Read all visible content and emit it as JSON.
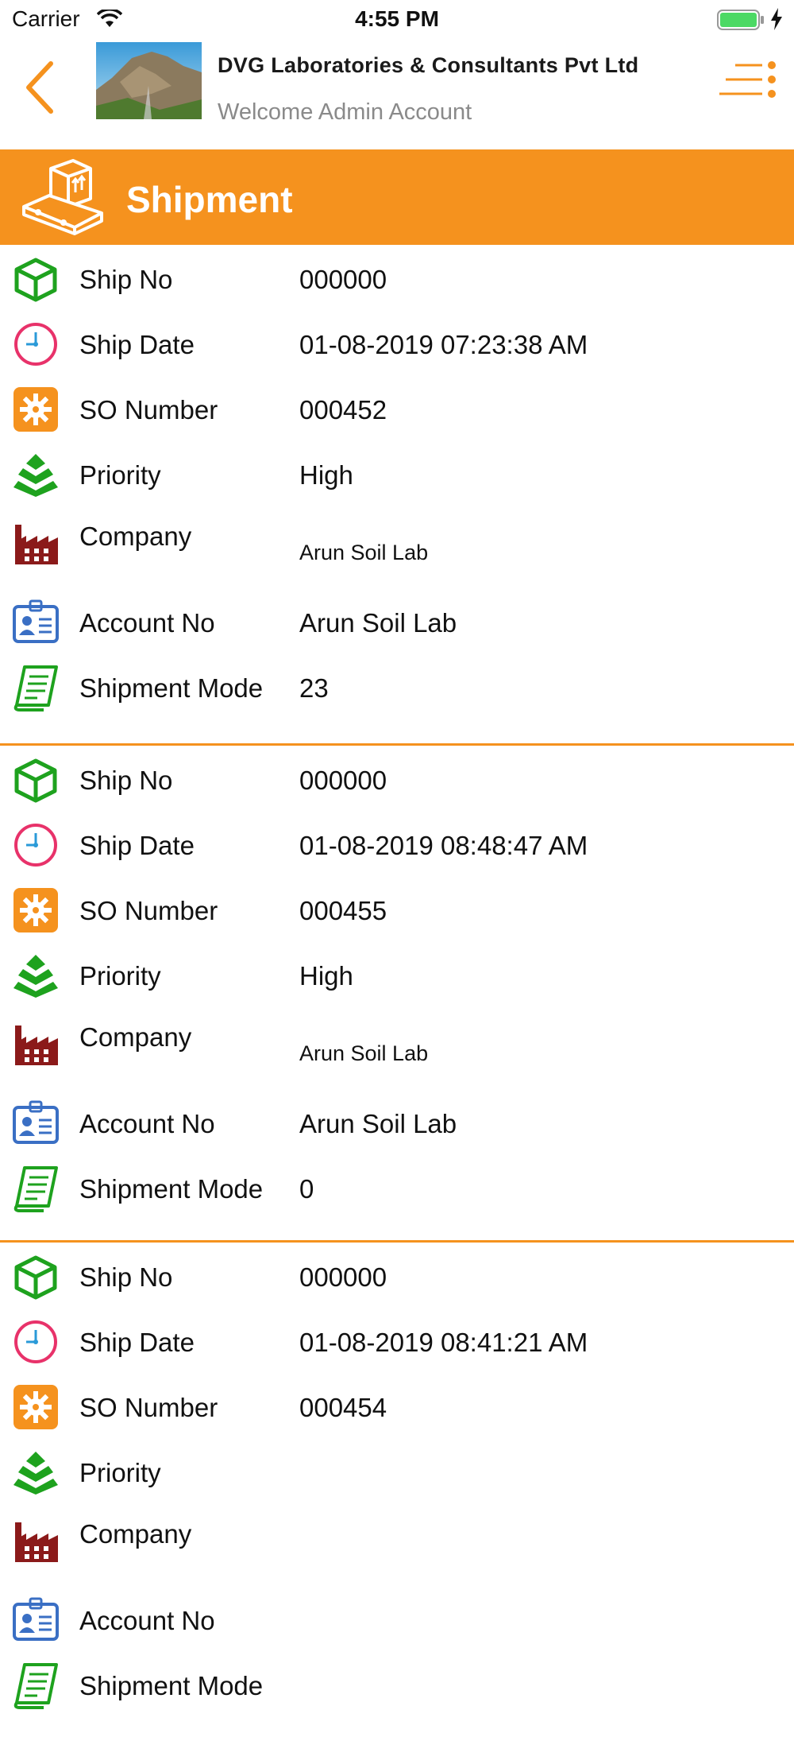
{
  "status_bar": {
    "carrier": "Carrier",
    "time": "4:55 PM"
  },
  "header": {
    "title": "DVG Laboratories & Consultants Pvt Ltd",
    "subtitle": "Welcome Admin Account"
  },
  "page": {
    "title": "Shipment"
  },
  "labels": {
    "ship_no": "Ship No",
    "ship_date": "Ship Date",
    "so_number": "SO Number",
    "priority": "Priority",
    "company": "Company",
    "account_no": "Account No",
    "shipment_mode": "Shipment Mode"
  },
  "shipments": [
    {
      "ship_no": "000000",
      "ship_date": "01-08-2019 07:23:38 AM",
      "so_number": "000452",
      "priority": "High",
      "company": "Arun Soil Lab",
      "account_no": "Arun Soil Lab",
      "shipment_mode": "23"
    },
    {
      "ship_no": "000000",
      "ship_date": "01-08-2019 08:48:47 AM",
      "so_number": "000455",
      "priority": "High",
      "company": "Arun Soil Lab",
      "account_no": "Arun Soil Lab",
      "shipment_mode": "0"
    },
    {
      "ship_no": "000000",
      "ship_date": "01-08-2019 08:41:21 AM",
      "so_number": "000454",
      "priority": "",
      "company": "",
      "account_no": "",
      "shipment_mode": ""
    }
  ],
  "icons": {
    "ship_no": "green-box-icon",
    "ship_date": "pink-clock-icon",
    "so_number": "orange-gear-icon",
    "priority": "green-layers-icon",
    "company": "red-factory-icon",
    "account_no": "blue-id-card-icon",
    "shipment_mode": "green-receipt-icon"
  },
  "colors": {
    "accent": "#f5921e",
    "green": "#1ea21e",
    "pink": "#e8326a",
    "factory_red": "#8b1a1a",
    "id_blue": "#3a6fc4"
  }
}
